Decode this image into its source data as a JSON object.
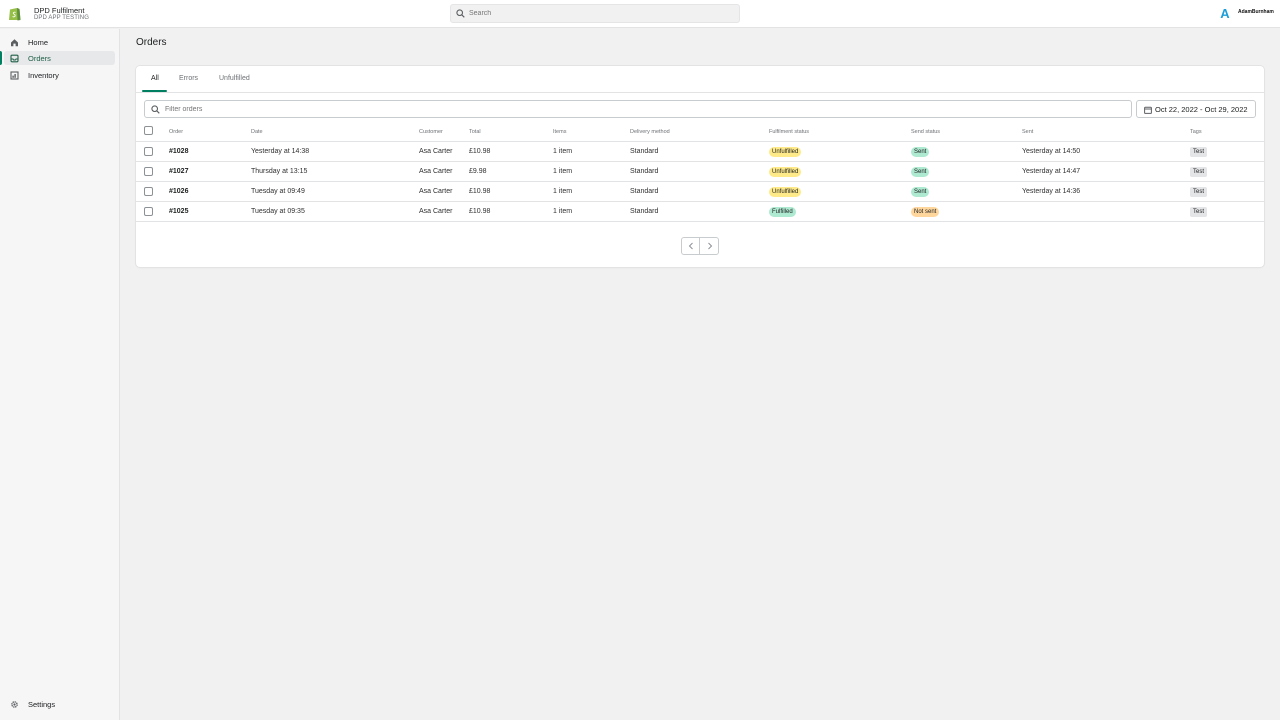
{
  "topbar": {
    "store_name": "DPD Fulfilment",
    "store_subtitle": "DPD APP TESTING",
    "search_placeholder": "Search",
    "avatar_letter": "A",
    "username": "AdamBurnham"
  },
  "sidebar": {
    "items": [
      {
        "label": "Home",
        "icon": "home-icon"
      },
      {
        "label": "Orders",
        "icon": "orders-icon",
        "active": true
      },
      {
        "label": "Inventory",
        "icon": "inventory-icon"
      }
    ],
    "settings_label": "Settings"
  },
  "page": {
    "title": "Orders"
  },
  "tabs": [
    {
      "label": "All",
      "active": true
    },
    {
      "label": "Errors"
    },
    {
      "label": "Unfulfilled"
    }
  ],
  "filter": {
    "placeholder": "Filter orders",
    "date_range": "Oct 22, 2022 - Oct 29, 2022"
  },
  "table": {
    "columns": [
      "Order",
      "Date",
      "Customer",
      "Total",
      "Items",
      "Delivery method",
      "Fulfilment status",
      "Send status",
      "Sent",
      "Tags"
    ],
    "rows": [
      {
        "order": "#1028",
        "date": "Yesterday at 14:38",
        "customer": "Asa Carter",
        "total": "£10.98",
        "items": "1 item",
        "delivery": "Standard",
        "fulfilment": "Unfulfilled",
        "send": "Sent",
        "sent": "Yesterday at 14:50",
        "tag": "Test"
      },
      {
        "order": "#1027",
        "date": "Thursday at 13:15",
        "customer": "Asa Carter",
        "total": "£9.98",
        "items": "1 item",
        "delivery": "Standard",
        "fulfilment": "Unfulfilled",
        "send": "Sent",
        "sent": "Yesterday at 14:47",
        "tag": "Test"
      },
      {
        "order": "#1026",
        "date": "Tuesday at 09:49",
        "customer": "Asa Carter",
        "total": "£10.98",
        "items": "1 item",
        "delivery": "Standard",
        "fulfilment": "Unfulfilled",
        "send": "Sent",
        "sent": "Yesterday at 14:36",
        "tag": "Test"
      },
      {
        "order": "#1025",
        "date": "Tuesday at 09:35",
        "customer": "Asa Carter",
        "total": "£10.98",
        "items": "1 item",
        "delivery": "Standard",
        "fulfilment": "Fulfilled",
        "send": "Not sent",
        "sent": "",
        "tag": "Test"
      }
    ]
  },
  "colors": {
    "accent": "#008060",
    "unfulfilled_badge": "#ffea8a",
    "fulfilled_badge": "#aee9d1",
    "sent_badge": "#aee9d1",
    "not_sent_badge": "#ffd79d"
  }
}
